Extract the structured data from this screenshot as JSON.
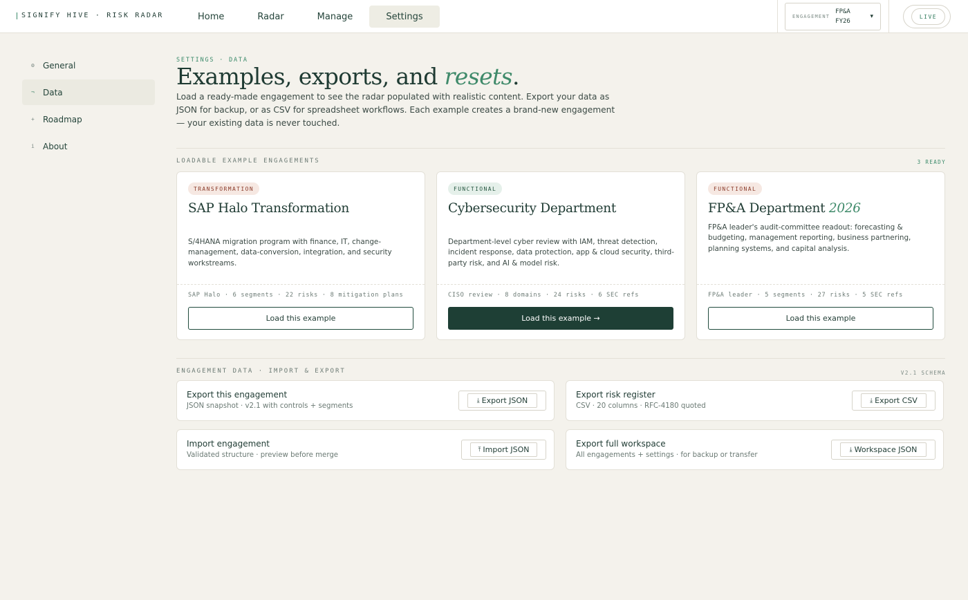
{
  "brand": {
    "name": "SIGNIFY HIVE · RISK RADAR"
  },
  "nav": [
    {
      "label": "Home"
    },
    {
      "label": "Radar"
    },
    {
      "label": "Manage"
    },
    {
      "label": "Settings",
      "active": true
    }
  ],
  "engagement": {
    "label": "ENGAGEMENT",
    "value": "FP&A FY26",
    "caret": "▾"
  },
  "live": {
    "label": "LIVE"
  },
  "sidebar": [
    {
      "icon": "⚙",
      "label": "General"
    },
    {
      "icon": "¬",
      "label": "Data",
      "active": true
    },
    {
      "icon": "+",
      "label": "Roadmap"
    },
    {
      "icon": "i",
      "label": "About"
    }
  ],
  "header": {
    "eyebrow": "SETTINGS · DATA",
    "title_main": "Examples, exports, and ",
    "title_em": "resets",
    "title_end": ".",
    "lead": "Load a ready-made engagement to see the radar populated with realistic content. Export your data as JSON for backup, or as CSV for spreadsheet workflows. Each example creates a brand-new engagement — your existing data is never touched."
  },
  "examples_section": {
    "title": "LOADABLE EXAMPLE ENGAGEMENTS",
    "count": "3 READY"
  },
  "examples": [
    {
      "tag": "TRANSFORMATION",
      "title": "SAP Halo Transformation",
      "title_em": "",
      "desc": "S/4HANA migration program with finance, IT, change-management, data-conversion, integration, and security workstreams.",
      "meta": "SAP Halo · 6 segments · 22 risks · 8 mitigation plans",
      "button": "Load this example"
    },
    {
      "tag": "FUNCTIONAL",
      "title": "Cybersecurity Department",
      "title_em": "",
      "desc": "Department-level cyber review with IAM, threat detection, incident response, data protection, app & cloud security, third-party risk, and AI & model risk.",
      "meta": "CISO review · 8 domains · 24 risks · 6 SEC refs",
      "button": "Load this example →"
    },
    {
      "tag": "FUNCTIONAL",
      "title": "FP&A Department ",
      "title_em": "2026",
      "desc": "FP&A leader's audit-committee readout: forecasting & budgeting, management reporting, business partnering, planning systems, and capital analysis.",
      "meta": "FP&A leader · 5 segments · 27 risks · 5 SEC refs",
      "button": "Load this example"
    }
  ],
  "data_section": {
    "title": "ENGAGEMENT DATA · IMPORT & EXPORT",
    "schema": "V2.1 SCHEMA"
  },
  "data_actions": [
    {
      "title": "Export this engagement",
      "sub": "JSON snapshot · v2.1 with controls + segments",
      "icon": "⤓",
      "button": "Export JSON"
    },
    {
      "title": "Export risk register",
      "sub": "CSV · 20 columns · RFC-4180 quoted",
      "icon": "⤓",
      "button": "Export CSV"
    },
    {
      "title": "Import engagement",
      "sub": "Validated structure · preview before merge",
      "icon": "⤒",
      "button": "Import JSON"
    },
    {
      "title": "Export full workspace",
      "sub": "All engagements + settings · for backup or transfer",
      "icon": "⤓",
      "button": "Workspace JSON"
    }
  ]
}
